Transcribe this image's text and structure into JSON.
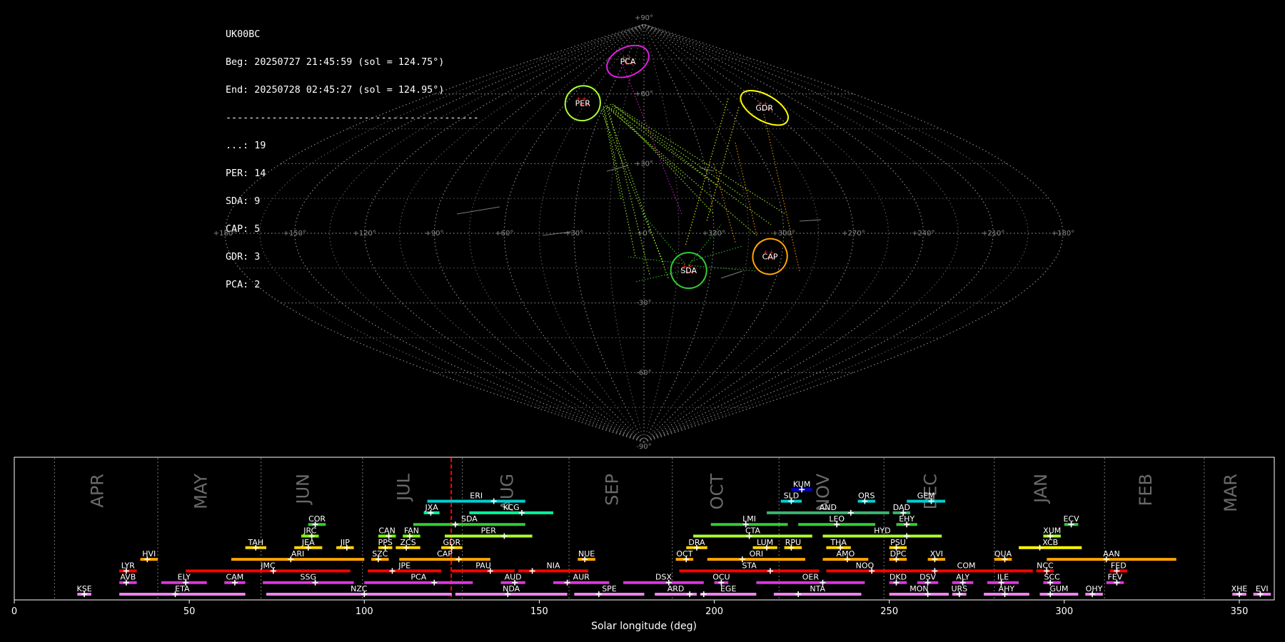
{
  "info": {
    "station": "UK00BC",
    "begin": "Beg: 20250727 21:45:59 (sol = 124.75°)",
    "end": "End: 20250728 02:45:27 (sol = 124.95°)",
    "separator": "--------------------------------------------",
    "counts": [
      "...: 19",
      "PER: 14",
      "SDA: 9",
      "CAP: 5",
      "GDR: 3",
      "PCA: 2"
    ]
  },
  "sky_map": {
    "projection": "sinusoidal",
    "lon_labels": [
      "+180°",
      "+150°",
      "+120°",
      "+90°",
      "+60°",
      "+30°",
      "+0°",
      "+330°",
      "+300°",
      "+270°",
      "+240°",
      "+210°",
      "+180°"
    ],
    "lat_labels": [
      "+90°",
      "+60°",
      "+30°",
      "-30°",
      "-60°",
      "-90°"
    ],
    "radiants": [
      {
        "code": "PCA",
        "ra": 25,
        "dec": 74,
        "color": "#e21ee2"
      },
      {
        "code": "PER",
        "ra": 47,
        "dec": 56,
        "color": "#adff2f"
      },
      {
        "code": "GDR",
        "ra": 272,
        "dec": 54,
        "color": "#ffff00"
      },
      {
        "code": "CAP",
        "ra": 305,
        "dec": -10,
        "color": "#ffa500"
      },
      {
        "code": "SDA",
        "ra": 340,
        "dec": -16,
        "color": "#32cd32"
      }
    ]
  },
  "chart_data": {
    "type": "timeline",
    "xlabel": "Solar longitude (deg)",
    "xlim": [
      0,
      360
    ],
    "x_ticks": [
      0,
      50,
      100,
      150,
      200,
      250,
      300,
      350
    ],
    "current_sol": 124.85,
    "months": [
      {
        "label": "APR",
        "start": 11.5,
        "end": 41
      },
      {
        "label": "MAY",
        "start": 41,
        "end": 70.5
      },
      {
        "label": "JUN",
        "start": 70.5,
        "end": 99.5
      },
      {
        "label": "JUL",
        "start": 99.5,
        "end": 128
      },
      {
        "label": "AUG",
        "start": 128,
        "end": 158.5
      },
      {
        "label": "SEP",
        "start": 158.5,
        "end": 188
      },
      {
        "label": "OCT",
        "start": 188,
        "end": 218.5
      },
      {
        "label": "NOV",
        "start": 218.5,
        "end": 248.5
      },
      {
        "label": "DEC",
        "start": 248.5,
        "end": 280
      },
      {
        "label": "JAN",
        "start": 280,
        "end": 311.5
      },
      {
        "label": "FEB",
        "start": 311.5,
        "end": 340
      },
      {
        "label": "MAR",
        "start": 340,
        "end": 371.5
      }
    ],
    "showers": [
      {
        "code": "KUM",
        "start": 222,
        "end": 228,
        "peak": 225,
        "level": 10,
        "color": "#0000cd"
      },
      {
        "code": "ERI",
        "start": 118,
        "end": 146,
        "peak": 137,
        "level": 9,
        "color": "#00ced1"
      },
      {
        "code": "SLD",
        "start": 219,
        "end": 225,
        "peak": 222,
        "level": 9,
        "color": "#00ced1"
      },
      {
        "code": "ORS",
        "start": 241,
        "end": 246,
        "peak": 243,
        "level": 9,
        "color": "#00ced1"
      },
      {
        "code": "GEM",
        "start": 255,
        "end": 266,
        "peak": 262,
        "level": 9,
        "color": "#00ced1"
      },
      {
        "code": "JXA",
        "start": 117,
        "end": 121.5,
        "peak": 119,
        "level": 8,
        "color": "#00fa9a"
      },
      {
        "code": "KCG",
        "start": 130,
        "end": 154,
        "peak": 145,
        "level": 8,
        "color": "#00fa9a"
      },
      {
        "code": "AND",
        "start": 215,
        "end": 250,
        "peak": 239,
        "level": 8,
        "color": "#3cb371"
      },
      {
        "code": "DAD",
        "start": 251,
        "end": 256,
        "peak": 254,
        "level": 8,
        "color": "#3cb371"
      },
      {
        "code": "COR",
        "start": 84,
        "end": 89,
        "peak": 86,
        "level": 7,
        "color": "#32cd32"
      },
      {
        "code": "SDA",
        "start": 114,
        "end": 146,
        "peak": 126,
        "level": 7,
        "color": "#32cd32"
      },
      {
        "code": "LMI",
        "start": 199,
        "end": 221,
        "peak": 209,
        "level": 7,
        "color": "#32cd32"
      },
      {
        "code": "LEO",
        "start": 224,
        "end": 246,
        "peak": 235,
        "level": 7,
        "color": "#32cd32"
      },
      {
        "code": "EHY",
        "start": 252,
        "end": 258,
        "peak": 255,
        "level": 7,
        "color": "#32cd32"
      },
      {
        "code": "ECV",
        "start": 300,
        "end": 304,
        "peak": 302,
        "level": 7,
        "color": "#32cd32"
      },
      {
        "code": "JRC",
        "start": 82,
        "end": 87,
        "peak": 85,
        "level": 6,
        "color": "#7cfc00"
      },
      {
        "code": "CAN",
        "start": 104,
        "end": 109,
        "peak": 107,
        "level": 6,
        "color": "#7cfc00"
      },
      {
        "code": "FAN",
        "start": 111,
        "end": 116,
        "peak": 113,
        "level": 6,
        "color": "#7cfc00"
      },
      {
        "code": "PER",
        "start": 123,
        "end": 148,
        "peak": 140,
        "level": 6,
        "color": "#adff2f"
      },
      {
        "code": "CTA",
        "start": 194,
        "end": 228,
        "peak": 210,
        "level": 6,
        "color": "#adff2f"
      },
      {
        "code": "HYD",
        "start": 231,
        "end": 265,
        "peak": 255,
        "level": 6,
        "color": "#adff2f"
      },
      {
        "code": "XUM",
        "start": 294,
        "end": 299,
        "peak": 296,
        "level": 6,
        "color": "#adff2f"
      },
      {
        "code": "TAH",
        "start": 66,
        "end": 72,
        "peak": 69,
        "level": 5,
        "color": "#ffd700"
      },
      {
        "code": "JEA",
        "start": 80,
        "end": 88,
        "peak": 84,
        "level": 5,
        "color": "#ffd700"
      },
      {
        "code": "JIP",
        "start": 92,
        "end": 97,
        "peak": 95,
        "level": 5,
        "color": "#ffd700"
      },
      {
        "code": "PPS",
        "start": 104,
        "end": 108,
        "peak": 106,
        "level": 5,
        "color": "#ffd700"
      },
      {
        "code": "ZCS",
        "start": 109,
        "end": 116,
        "peak": 112,
        "level": 5,
        "color": "#ffd700"
      },
      {
        "code": "GDR",
        "start": 122,
        "end": 128,
        "peak": 125,
        "level": 5,
        "color": "#ffd700"
      },
      {
        "code": "DRA",
        "start": 192,
        "end": 198,
        "peak": 195,
        "level": 5,
        "color": "#ffd700"
      },
      {
        "code": "LUM",
        "start": 211,
        "end": 218,
        "peak": 215,
        "level": 5,
        "color": "#ffd700"
      },
      {
        "code": "RPU",
        "start": 220,
        "end": 225,
        "peak": 222,
        "level": 5,
        "color": "#ffd700"
      },
      {
        "code": "THA",
        "start": 232,
        "end": 239,
        "peak": 236,
        "level": 5,
        "color": "#ffd700"
      },
      {
        "code": "PSU",
        "start": 250,
        "end": 255,
        "peak": 252,
        "level": 5,
        "color": "#ffd700"
      },
      {
        "code": "XCB",
        "start": 287,
        "end": 305,
        "peak": 293,
        "level": 5,
        "color": "#ffff00"
      },
      {
        "code": "HVI",
        "start": 36,
        "end": 41,
        "peak": 38,
        "level": 4,
        "color": "#ffa500"
      },
      {
        "code": "ARI",
        "start": 62,
        "end": 100,
        "peak": 79,
        "level": 4,
        "color": "#ffa500"
      },
      {
        "code": "SZC",
        "start": 102,
        "end": 107,
        "peak": 104,
        "level": 4,
        "color": "#ffa500"
      },
      {
        "code": "CAP",
        "start": 110,
        "end": 136,
        "peak": 127,
        "level": 4,
        "color": "#ffa500"
      },
      {
        "code": "NUE",
        "start": 161,
        "end": 166,
        "peak": 163,
        "level": 4,
        "color": "#ffa500"
      },
      {
        "code": "OCT",
        "start": 189,
        "end": 194,
        "peak": 192,
        "level": 4,
        "color": "#ffa500"
      },
      {
        "code": "ORI",
        "start": 198,
        "end": 226,
        "peak": 208,
        "level": 4,
        "color": "#ffa500"
      },
      {
        "code": "AMO",
        "start": 231,
        "end": 244,
        "peak": 238,
        "level": 4,
        "color": "#ffa500"
      },
      {
        "code": "DPC",
        "start": 250,
        "end": 255,
        "peak": 252,
        "level": 4,
        "color": "#ffa500"
      },
      {
        "code": "XVI",
        "start": 261,
        "end": 266,
        "peak": 263,
        "level": 4,
        "color": "#ffa500"
      },
      {
        "code": "QUA",
        "start": 280,
        "end": 285,
        "peak": 283,
        "level": 4,
        "color": "#ffa500"
      },
      {
        "code": "AAN",
        "start": 295,
        "end": 332,
        "peak": 312,
        "level": 4,
        "color": "#ffa500"
      },
      {
        "code": "LYR",
        "start": 30,
        "end": 35,
        "peak": 32,
        "level": 3,
        "color": "#ff0000"
      },
      {
        "code": "JMC",
        "start": 49,
        "end": 96,
        "peak": 74,
        "level": 3,
        "color": "#ff0000"
      },
      {
        "code": "JPE",
        "start": 101,
        "end": 122,
        "peak": 108,
        "level": 3,
        "color": "#ff0000"
      },
      {
        "code": "PAU",
        "start": 125,
        "end": 143,
        "peak": 136,
        "level": 3,
        "color": "#ff0000"
      },
      {
        "code": "NIA",
        "start": 144,
        "end": 164,
        "peak": 148,
        "level": 3,
        "color": "#ff0000"
      },
      {
        "code": "STA",
        "start": 190,
        "end": 230,
        "peak": 216,
        "level": 3,
        "color": "#ff0000"
      },
      {
        "code": "NOO",
        "start": 232,
        "end": 254,
        "peak": 245,
        "level": 3,
        "color": "#ff0000"
      },
      {
        "code": "COM",
        "start": 253,
        "end": 291,
        "peak": 263,
        "level": 3,
        "color": "#ff0000"
      },
      {
        "code": "NCC",
        "start": 292,
        "end": 297,
        "peak": 295,
        "level": 3,
        "color": "#ff0000"
      },
      {
        "code": "FED",
        "start": 313,
        "end": 318,
        "peak": 315,
        "level": 3,
        "color": "#ff0000"
      },
      {
        "code": "AVB",
        "start": 30,
        "end": 35,
        "peak": 32,
        "level": 2,
        "color": "#da36da"
      },
      {
        "code": "ELY",
        "start": 42,
        "end": 55,
        "peak": 49,
        "level": 2,
        "color": "#da36da"
      },
      {
        "code": "CAM",
        "start": 60,
        "end": 66,
        "peak": 63,
        "level": 2,
        "color": "#da36da"
      },
      {
        "code": "SSG",
        "start": 71,
        "end": 97,
        "peak": 86,
        "level": 2,
        "color": "#da36da"
      },
      {
        "code": "PCA",
        "start": 100,
        "end": 131,
        "peak": 120,
        "level": 2,
        "color": "#da36da"
      },
      {
        "code": "AUD",
        "start": 139,
        "end": 146,
        "peak": 143,
        "level": 2,
        "color": "#da36da"
      },
      {
        "code": "AUR",
        "start": 154,
        "end": 170,
        "peak": 158,
        "level": 2,
        "color": "#da36da"
      },
      {
        "code": "DSX",
        "start": 174,
        "end": 197,
        "peak": 187,
        "level": 2,
        "color": "#da36da"
      },
      {
        "code": "OCU",
        "start": 200,
        "end": 204,
        "peak": 202,
        "level": 2,
        "color": "#da36da"
      },
      {
        "code": "OER",
        "start": 212,
        "end": 243,
        "peak": 231,
        "level": 2,
        "color": "#da36da"
      },
      {
        "code": "DKD",
        "start": 250,
        "end": 255,
        "peak": 252,
        "level": 2,
        "color": "#da36da"
      },
      {
        "code": "DSV",
        "start": 258,
        "end": 264,
        "peak": 261,
        "level": 2,
        "color": "#da36da"
      },
      {
        "code": "ALY",
        "start": 268,
        "end": 274,
        "peak": 271,
        "level": 2,
        "color": "#da36da"
      },
      {
        "code": "ILE",
        "start": 278,
        "end": 287,
        "peak": 282,
        "level": 2,
        "color": "#da36da"
      },
      {
        "code": "SCC",
        "start": 294,
        "end": 299,
        "peak": 296,
        "level": 2,
        "color": "#da36da"
      },
      {
        "code": "FEV",
        "start": 312,
        "end": 317,
        "peak": 315,
        "level": 2,
        "color": "#da36da"
      },
      {
        "code": "KSE",
        "start": 18,
        "end": 22,
        "peak": 20,
        "level": 1,
        "color": "#ee82ee"
      },
      {
        "code": "ETA",
        "start": 30,
        "end": 66,
        "peak": 46,
        "level": 1,
        "color": "#ee82ee"
      },
      {
        "code": "NZC",
        "start": 72,
        "end": 125,
        "peak": 100,
        "level": 1,
        "color": "#ee82ee"
      },
      {
        "code": "NDA",
        "start": 126,
        "end": 158,
        "peak": 141,
        "level": 1,
        "color": "#ee82ee"
      },
      {
        "code": "SPE",
        "start": 160,
        "end": 180,
        "peak": 167,
        "level": 1,
        "color": "#ee82ee"
      },
      {
        "code": "ARD",
        "start": 183,
        "end": 195,
        "peak": 193,
        "level": 1,
        "color": "#ee82ee"
      },
      {
        "code": "EGE",
        "start": 196,
        "end": 212,
        "peak": 197,
        "level": 1,
        "color": "#ee82ee"
      },
      {
        "code": "NTA",
        "start": 217,
        "end": 242,
        "peak": 224,
        "level": 1,
        "color": "#ee82ee"
      },
      {
        "code": "MON",
        "start": 250,
        "end": 267,
        "peak": 261,
        "level": 1,
        "color": "#ee82ee"
      },
      {
        "code": "URS",
        "start": 268,
        "end": 272,
        "peak": 270,
        "level": 1,
        "color": "#ee82ee"
      },
      {
        "code": "AHY",
        "start": 277,
        "end": 290,
        "peak": 283,
        "level": 1,
        "color": "#ee82ee"
      },
      {
        "code": "GUM",
        "start": 293,
        "end": 304,
        "peak": 296,
        "level": 1,
        "color": "#ee82ee"
      },
      {
        "code": "OHY",
        "start": 306,
        "end": 311,
        "peak": 308,
        "level": 1,
        "color": "#ee82ee"
      },
      {
        "code": "XHE",
        "start": 348,
        "end": 352,
        "peak": 350,
        "level": 1,
        "color": "#ee82ee"
      },
      {
        "code": "EVI",
        "start": 354,
        "end": 359,
        "peak": 356,
        "level": 1,
        "color": "#ee82ee"
      }
    ]
  }
}
